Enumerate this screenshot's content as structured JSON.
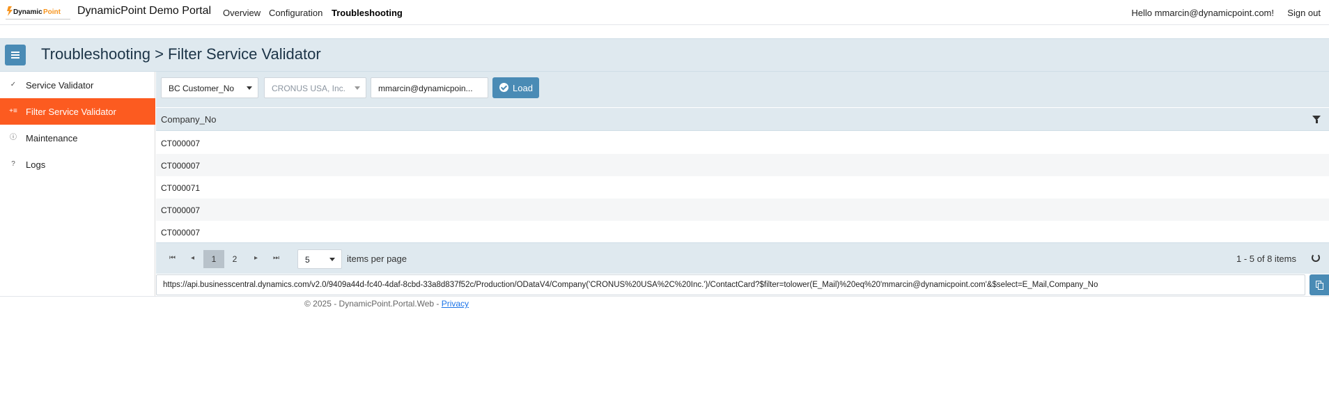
{
  "nav": {
    "brand": "DynamicPoint Demo Portal",
    "links": [
      "Overview",
      "Configuration",
      "Troubleshooting"
    ],
    "active": "Troubleshooting",
    "hello": "Hello mmarcin@dynamicpoint.com!",
    "sign_out": "Sign out"
  },
  "logo": {
    "text_main": "DynamicPoint",
    "accent_color": "#f7941d"
  },
  "header": {
    "title": "Troubleshooting > Filter Service Validator"
  },
  "sidebar": {
    "items": [
      {
        "label": "Service Validator",
        "icon": "check-icon"
      },
      {
        "label": "Filter Service Validator",
        "icon": "filter-list-icon",
        "active": true
      },
      {
        "label": "Maintenance",
        "icon": "info-circle-icon"
      },
      {
        "label": "Logs",
        "icon": "question-circle-icon"
      }
    ]
  },
  "filters": {
    "field": "BC Customer_No",
    "company": "CRONUS USA, Inc.",
    "email": "mmarcin@dynamicpoin...",
    "load_label": "Load"
  },
  "grid": {
    "column": "Company_No",
    "rows": [
      "CT000007",
      "CT000007",
      "CT000071",
      "CT000007",
      "CT000007"
    ]
  },
  "pager": {
    "pages": [
      "1",
      "2"
    ],
    "current": "1",
    "page_size": "5",
    "items_per_page_label": "items per page",
    "info": "1 - 5 of 8 items"
  },
  "url": "https://api.businesscentral.dynamics.com/v2.0/9409a44d-fc40-4daf-8cbd-33a8d837f52c/Production/ODataV4/Company('CRONUS%20USA%2C%20Inc.')/ContactCard?$filter=tolower(E_Mail)%20eq%20'mmarcin@dynamicpoint.com'&$select=E_Mail,Company_No",
  "footer": {
    "text": "© 2025 - DynamicPoint.Portal.Web - ",
    "privacy": "Privacy"
  },
  "colors": {
    "accent_orange": "#fc5b20",
    "primary_blue": "#4a8bb5",
    "header_bg": "#dfe9ef"
  }
}
